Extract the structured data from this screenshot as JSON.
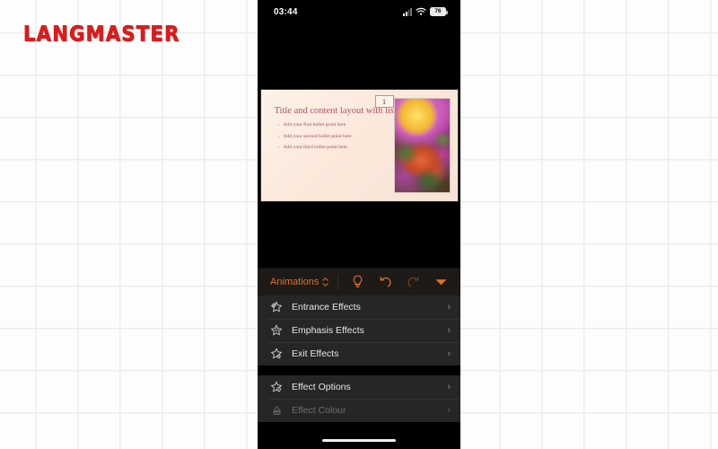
{
  "brand": {
    "name": "LANGMASTER"
  },
  "phone": {
    "status_bar": {
      "time": "03:44",
      "signal_icon": "cellular-signal-icon",
      "wifi_icon": "wifi-icon",
      "battery_level": "76"
    },
    "home_indicator": "home-indicator"
  },
  "slide": {
    "number": "1",
    "title": "Title and content layout with list",
    "bullets": [
      "Add your first bullet point here",
      "Add your second bullet point here",
      "Add your third bullet point here"
    ],
    "image_alt": "pink dahlia and orange flowers photo"
  },
  "toolbar": {
    "tab_label": "Animations",
    "tab_selector_icon": "chevron-up-down-icon",
    "buttons": [
      {
        "name": "lightbulb-icon",
        "enabled": true
      },
      {
        "name": "undo-icon",
        "enabled": true
      },
      {
        "name": "redo-icon",
        "enabled": false
      },
      {
        "name": "collapse-ribbon-icon",
        "enabled": true
      }
    ],
    "accent_color": "#e0702a"
  },
  "menu": {
    "group1": [
      {
        "label": "Entrance Effects",
        "icon": "star-entrance-icon",
        "enabled": true
      },
      {
        "label": "Emphasis Effects",
        "icon": "star-emphasis-icon",
        "enabled": true
      },
      {
        "label": "Exit Effects",
        "icon": "star-exit-icon",
        "enabled": true
      }
    ],
    "group2": [
      {
        "label": "Effect Options",
        "icon": "star-options-icon",
        "enabled": true
      },
      {
        "label": "Effect Colour",
        "icon": "paint-bucket-icon",
        "enabled": false
      }
    ],
    "chevron": "›"
  },
  "colors": {
    "background": "#fdfdfd",
    "grid_line": "#ededed",
    "brand_red": "#e01b1b",
    "menu_surface": "#262626",
    "toolbar_surface": "#1d1a17"
  }
}
